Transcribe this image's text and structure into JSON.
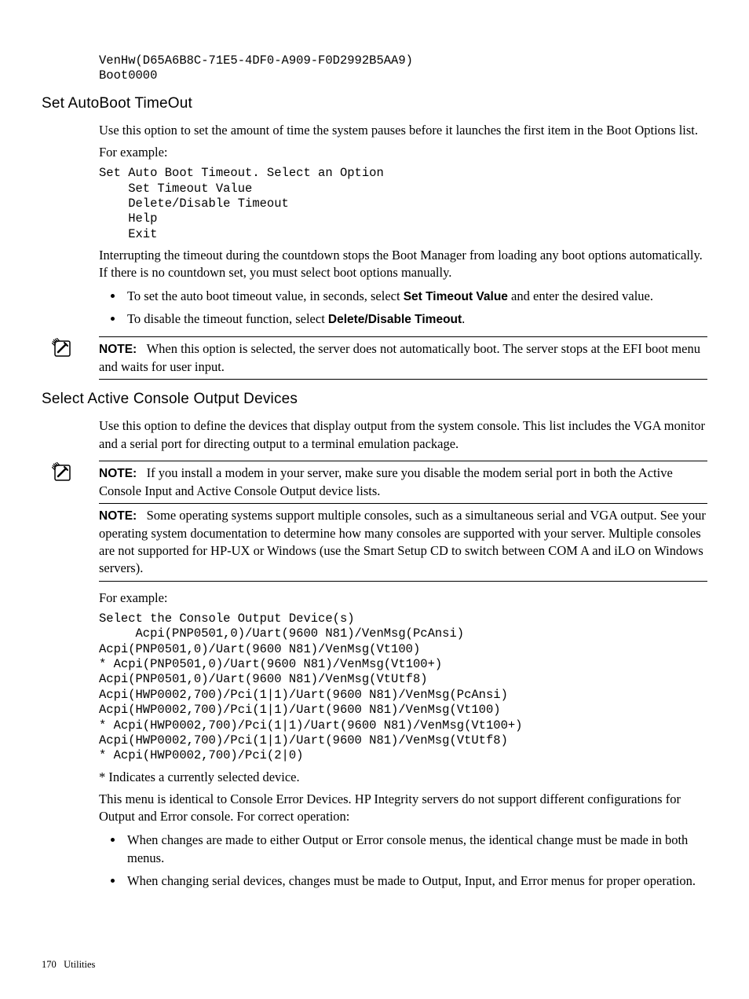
{
  "code_intro": "VenHw(D65A6B8C-71E5-4DF0-A909-F0D2992B5AA9)\nBoot0000",
  "section1": {
    "heading": "Set AutoBoot TimeOut",
    "p1": "Use this option to set the amount of time the system pauses before it launches the first item in the Boot Options list.",
    "for_example": "For example:",
    "code": "Set Auto Boot Timeout. Select an Option\n    Set Timeout Value\n    Delete/Disable Timeout\n    Help\n    Exit",
    "p2": "Interrupting the timeout during the countdown stops the Boot Manager from loading any boot options automatically. If there is no countdown set, you must select boot options manually.",
    "bullets": {
      "b1_pre": "To set the auto boot timeout value, in seconds, select ",
      "b1_bold": "Set Timeout Value",
      "b1_post": " and enter the desired value.",
      "b2_pre": "To disable the timeout function, select ",
      "b2_bold": "Delete/Disable Timeout",
      "b2_post": "."
    },
    "note_label": "NOTE:",
    "note_text": "When this option is selected, the server does not automatically boot. The server stops at the EFI boot menu and waits for user input."
  },
  "section2": {
    "heading": "Select Active Console Output Devices",
    "p1": "Use this option to define the devices that display output from the system console. This list includes the VGA monitor and a serial port for directing output to a terminal emulation package.",
    "note1_label": "NOTE:",
    "note1_text": "If you install a modem in your server, make sure you disable the modem serial port in both the Active Console Input and Active Console Output device lists.",
    "note2_label": "NOTE:",
    "note2_text": "Some operating systems support multiple consoles, such as a simultaneous serial and VGA output. See your operating system documentation to determine how many consoles are supported with your server. Multiple consoles are not supported for HP-UX or Windows (use the Smart Setup CD to switch between COM A and iLO on Windows servers).",
    "for_example": "For example:",
    "code": "Select the Console Output Device(s)\n     Acpi(PNP0501,0)/Uart(9600 N81)/VenMsg(PcAnsi)\nAcpi(PNP0501,0)/Uart(9600 N81)/VenMsg(Vt100)\n* Acpi(PNP0501,0)/Uart(9600 N81)/VenMsg(Vt100+)\nAcpi(PNP0501,0)/Uart(9600 N81)/VenMsg(VtUtf8)\nAcpi(HWP0002,700)/Pci(1|1)/Uart(9600 N81)/VenMsg(PcAnsi)\nAcpi(HWP0002,700)/Pci(1|1)/Uart(9600 N81)/VenMsg(Vt100)\n* Acpi(HWP0002,700)/Pci(1|1)/Uart(9600 N81)/VenMsg(Vt100+)\nAcpi(HWP0002,700)/Pci(1|1)/Uart(9600 N81)/VenMsg(VtUtf8)\n* Acpi(HWP0002,700)/Pci(2|0)",
    "p2": "* Indicates a currently selected device.",
    "p3": "This menu is identical to Console Error Devices. HP Integrity servers do not support different configurations for Output and Error console. For correct operation:",
    "bullets": {
      "b1": "When changes are made to either Output or Error console menus, the identical change must be made in both menus.",
      "b2": "When changing serial devices, changes must be made to Output, Input, and Error menus for proper operation."
    }
  },
  "footer": {
    "page": "170",
    "chapter": "Utilities"
  }
}
